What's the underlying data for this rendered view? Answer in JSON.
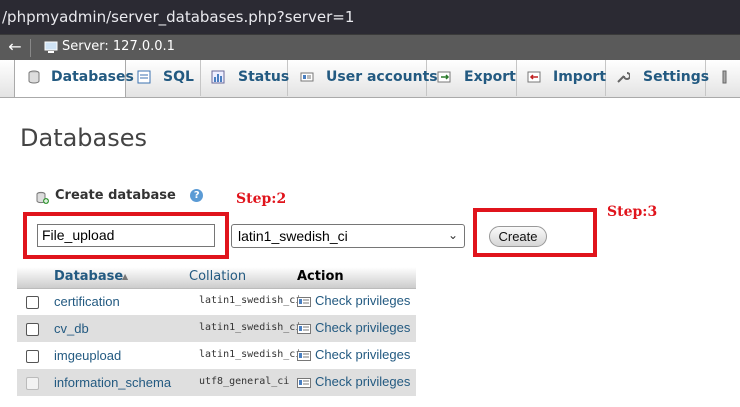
{
  "browser": {
    "url": "/phpmyadmin/server_databases.php?server=1"
  },
  "server_bar": {
    "back_label": "←",
    "label": "Server: 127.0.0.1"
  },
  "tabs": [
    {
      "label": "Databases",
      "icon": "database-icon",
      "active": true
    },
    {
      "label": "SQL",
      "icon": "sql-icon"
    },
    {
      "label": "Status",
      "icon": "status-icon"
    },
    {
      "label": "User accounts",
      "icon": "user-accounts-icon"
    },
    {
      "label": "Export",
      "icon": "export-icon"
    },
    {
      "label": "Import",
      "icon": "import-icon"
    },
    {
      "label": "Settings",
      "icon": "wrench-icon"
    }
  ],
  "page": {
    "title": "Databases"
  },
  "create": {
    "heading": "Create database",
    "help": "?",
    "name_value": "File_upload",
    "collation_value": "latin1_swedish_ci",
    "button_label": "Create"
  },
  "annotations": {
    "step2": "Step:2",
    "step3": "Step:3",
    "color": "#e0141c"
  },
  "table": {
    "headers": {
      "database": "Database",
      "sort_arrow": "▲",
      "collation": "Collation",
      "action": "Action"
    },
    "rows": [
      {
        "name": "certification",
        "collation": "latin1_swedish_ci",
        "action": "Check privileges"
      },
      {
        "name": "cv_db",
        "collation": "latin1_swedish_ci",
        "action": "Check privileges"
      },
      {
        "name": "imgeupload",
        "collation": "latin1_swedish_ci",
        "action": "Check privileges"
      },
      {
        "name": "information_schema",
        "collation": "utf8_general_ci",
        "action": "Check privileges"
      }
    ]
  },
  "colors": {
    "link": "#235a81",
    "chrome": "#2b2a33",
    "server_bar": "#5a5a5a"
  }
}
